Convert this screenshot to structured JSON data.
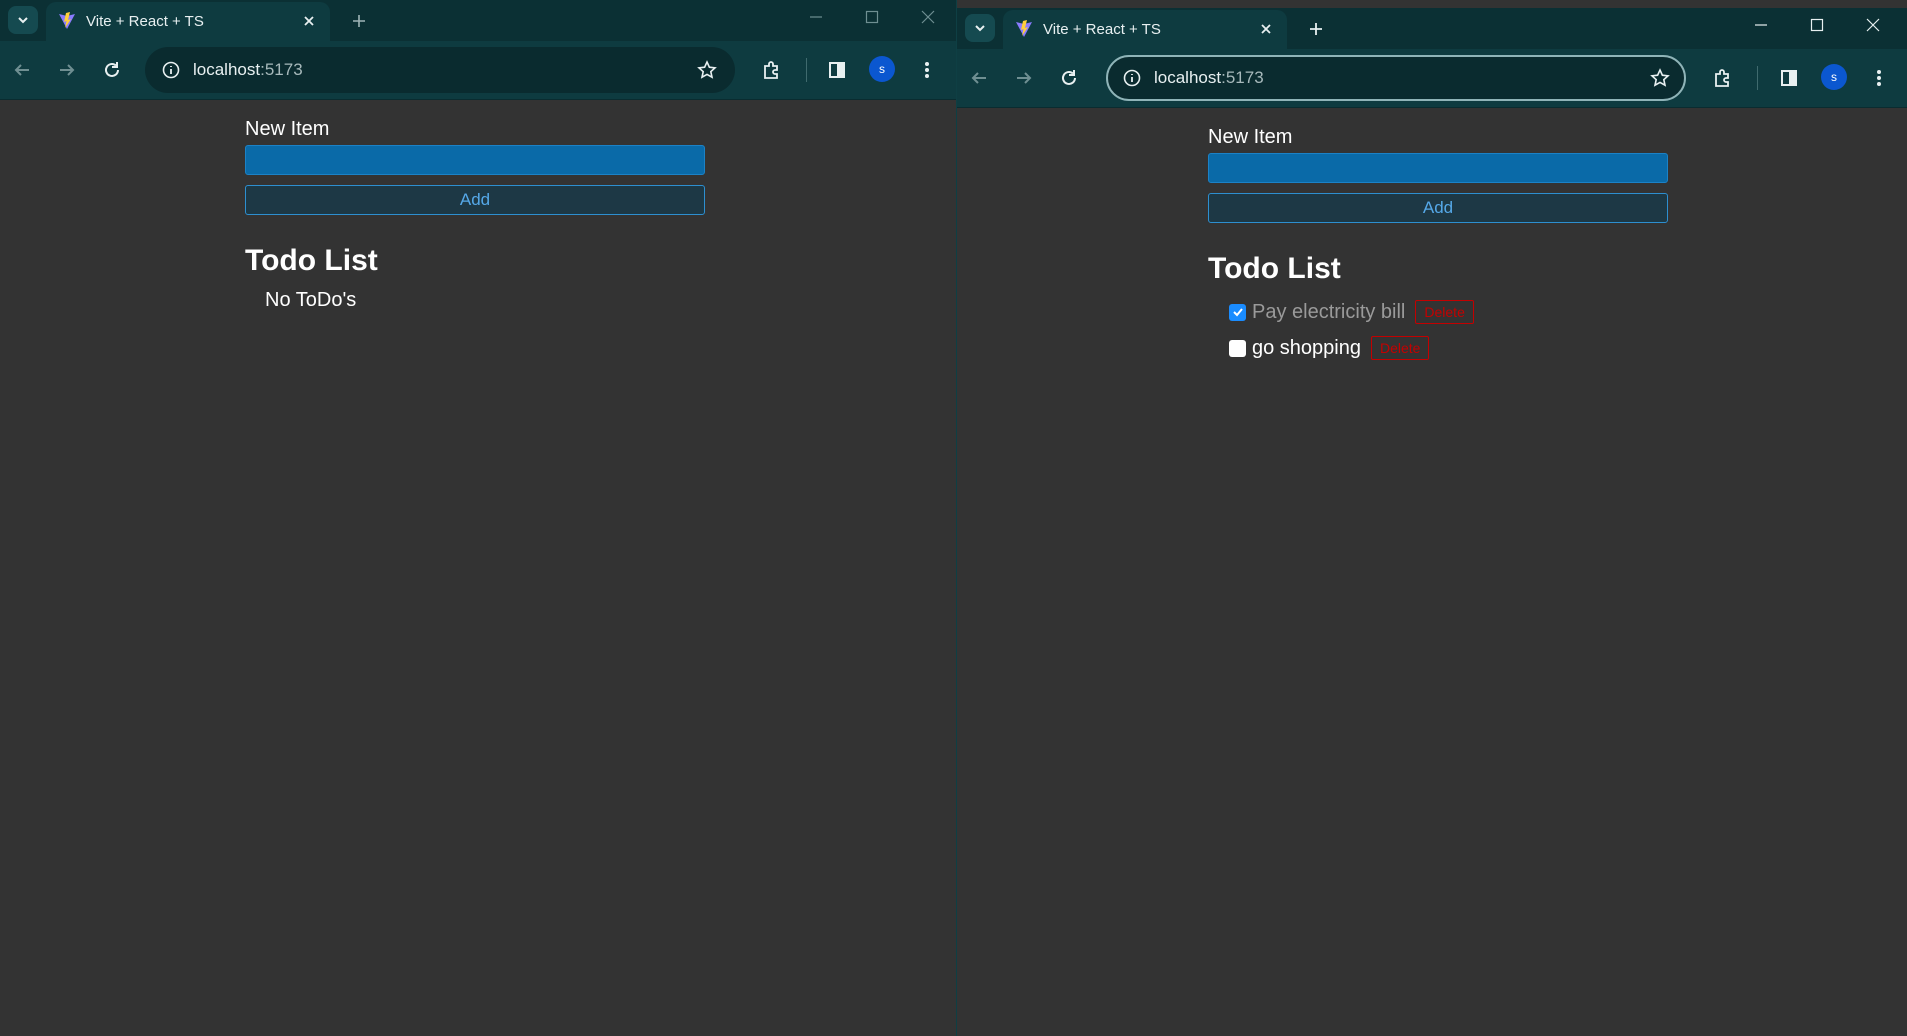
{
  "left": {
    "tab": {
      "title": "Vite + React + TS"
    },
    "address": {
      "host": "localhost",
      "port": ":5173"
    },
    "profile": {
      "initial": "s"
    },
    "form": {
      "label": "New Item",
      "input_value": "",
      "add_label": "Add"
    },
    "list": {
      "header": "Todo List",
      "empty_text": "No ToDo's",
      "items": []
    }
  },
  "right": {
    "tab": {
      "title": "Vite + React + TS"
    },
    "address": {
      "host": "localhost",
      "port": ":5173"
    },
    "profile": {
      "initial": "s"
    },
    "form": {
      "label": "New Item",
      "input_value": "",
      "add_label": "Add"
    },
    "list": {
      "header": "Todo List",
      "items": [
        {
          "title": "Pay electricity bill",
          "completed": true,
          "delete_label": "Delete"
        },
        {
          "title": "go shopping",
          "completed": false,
          "delete_label": "Delete"
        }
      ]
    }
  },
  "colors": {
    "chrome_frame": "#0b3034",
    "chrome_toolbar": "#0e3b40",
    "page_background": "#333333",
    "input_background": "#0a6aa8",
    "delete_red": "#c40000",
    "checkbox_blue": "#1a8cff"
  },
  "icons": {
    "tab_search": "chevron-down-icon",
    "favicon": "vite-logo-icon",
    "tab_close": "close-icon",
    "new_tab": "plus-icon",
    "minimize": "minimize-icon",
    "maximize": "maximize-icon",
    "close_window": "close-icon",
    "back": "arrow-left-icon",
    "forward": "arrow-right-icon",
    "reload": "reload-icon",
    "site_info": "info-circle-icon",
    "bookmark": "star-icon",
    "extensions": "puzzle-icon",
    "side_panel": "side-panel-icon",
    "menu": "kebab-menu-icon"
  }
}
